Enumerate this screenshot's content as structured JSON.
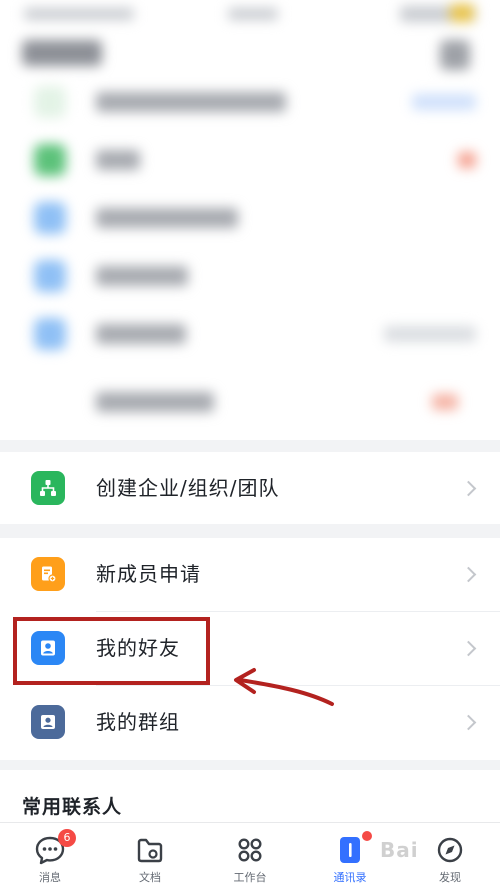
{
  "menu": {
    "items": [
      {
        "id": "create-org",
        "label": "创建企业/组织/团队",
        "icon": "org-chart-icon",
        "icon_color": "#2ab65d"
      },
      {
        "id": "new-member",
        "label": "新成员申请",
        "icon": "application-form-icon",
        "icon_color": "#ff9f1a"
      },
      {
        "id": "my-friends",
        "label": "我的好友",
        "icon": "person-icon",
        "icon_color": "#2b87f5"
      },
      {
        "id": "my-groups",
        "label": "我的群组",
        "icon": "group-icon",
        "icon_color": "#4c6a9a"
      }
    ]
  },
  "contacts": {
    "title": "常用联系人"
  },
  "tabbar": {
    "tabs": [
      {
        "label": "消息",
        "icon": "chat-bubble-icon",
        "badge": "6"
      },
      {
        "label": "文档",
        "icon": "document-folder-icon"
      },
      {
        "label": "工作台",
        "icon": "grid-apps-icon"
      },
      {
        "label": "通讯录",
        "icon": "contacts-book-icon",
        "active": true
      },
      {
        "label": "发现",
        "icon": "compass-icon"
      }
    ]
  },
  "colors": {
    "accent": "#3370ff",
    "highlight": "#b3221f",
    "badge": "#f54a45"
  },
  "watermark": "Bai"
}
